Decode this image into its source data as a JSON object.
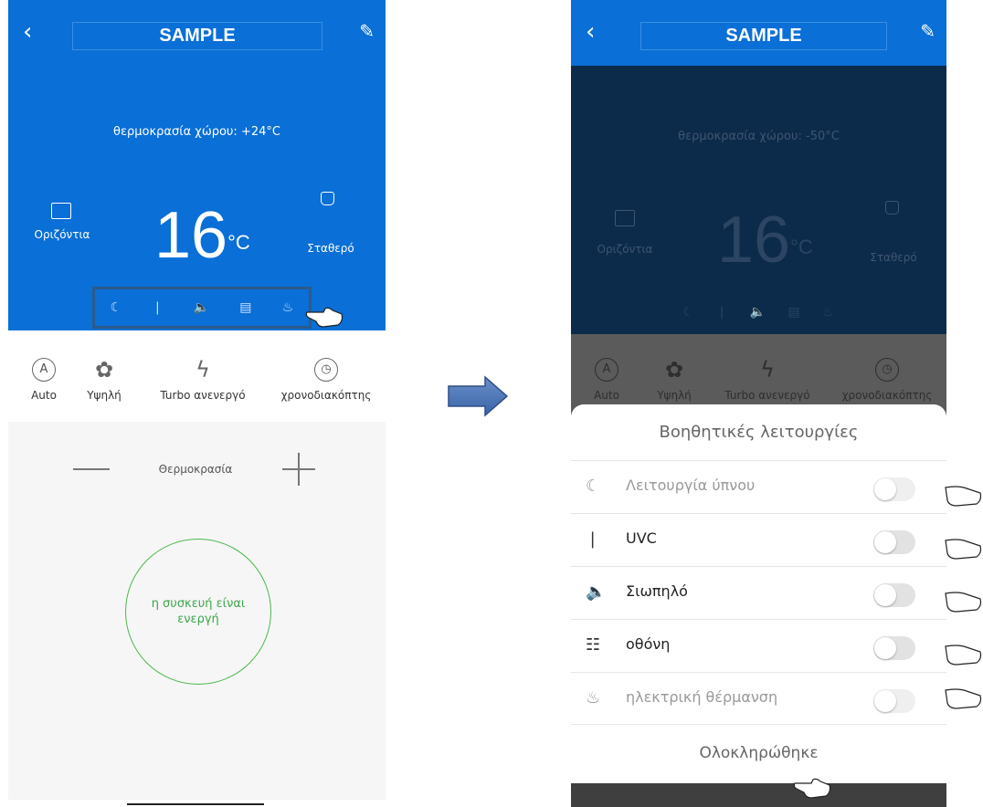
{
  "left": {
    "title": "SAMPLE",
    "room_temp": "θερμοκρασία χώρου: +24°C",
    "set_temp": "16",
    "unit": "°C",
    "swing_label": "Οριζόντια",
    "mode_label": "Σταθερό",
    "modes": [
      {
        "icon": "A",
        "label": "Auto"
      },
      {
        "icon": "fan-icon",
        "label": "Υψηλή"
      },
      {
        "icon": "lightning-icon",
        "label": "Turbo ανενεργό"
      },
      {
        "icon": "clock-icon",
        "label": "χρονοδιακόπτης"
      }
    ],
    "temp_label": "Θερμοκρασία",
    "device_status": "η συσκευή είναι ενεργή"
  },
  "right": {
    "title": "SAMPLE",
    "room_temp": "θερμοκρασία χώρου: -50°C",
    "set_temp": "16",
    "unit": "°C",
    "swing_label": "Οριζόντια",
    "mode_label": "Σταθερό",
    "modes": [
      {
        "label": "Auto"
      },
      {
        "label": "Υψηλή"
      },
      {
        "label": "Turbo ανενεργό"
      },
      {
        "label": "χρονοδιακόπτης"
      }
    ],
    "sheet_title": "Βοηθητικές λειτουργίες",
    "options": [
      {
        "icon": "moon-icon",
        "label": "Λειτουργία ύπνου",
        "enabled": false
      },
      {
        "icon": "leaf-icon",
        "label": "UVC",
        "enabled": true
      },
      {
        "icon": "speaker-icon",
        "label": "Σιωπηλό",
        "enabled": true
      },
      {
        "icon": "display-icon",
        "label": "οθόνη",
        "enabled": true
      },
      {
        "icon": "heat-icon",
        "label": "ηλεκτρική θέρμανση",
        "enabled": false
      }
    ],
    "done_label": "Ολοκληρώθηκε"
  },
  "colors": {
    "primary": "#0a6fd6",
    "dim": "#0c2a4a",
    "status": "#3aa84a"
  }
}
